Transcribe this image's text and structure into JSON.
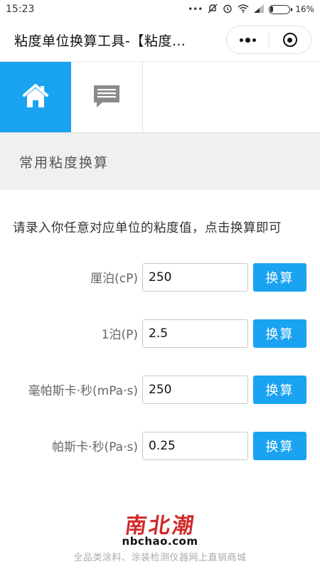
{
  "status_bar": {
    "time": "15:23",
    "battery_text": "16%",
    "battery_level": 0.16,
    "icons": [
      "more-dots-icon",
      "alarm-off-icon",
      "alarm-clock-icon",
      "wifi-icon",
      "signal-icon",
      "battery-icon"
    ]
  },
  "title_bar": {
    "title": "粘度单位换算工具-【粘度…"
  },
  "nav": {
    "tabs": [
      {
        "icon": "home-icon",
        "active": true
      },
      {
        "icon": "chat-icon",
        "active": false
      }
    ],
    "accent_color": "#1aa3f1"
  },
  "section": {
    "title": "常用粘度换算"
  },
  "intro": "请录入你任意对应单位的粘度值，点击换算即可",
  "converters": [
    {
      "label": "厘泊(cP)",
      "value": "250",
      "button": "换算"
    },
    {
      "label": "1泊(P)",
      "value": "2.5",
      "button": "换算"
    },
    {
      "label": "毫帕斯卡·秒(mPa·s)",
      "value": "250",
      "button": "换算"
    },
    {
      "label": "帕斯卡·秒(Pa·s)",
      "value": "0.25",
      "button": "换算"
    }
  ],
  "footer": {
    "logo_cn": "南北潮",
    "logo_en": "nbchao.com",
    "slogan": "全品类涂料、涂装检测仪器网上直销商城",
    "logo_color": "#d12a2a"
  }
}
